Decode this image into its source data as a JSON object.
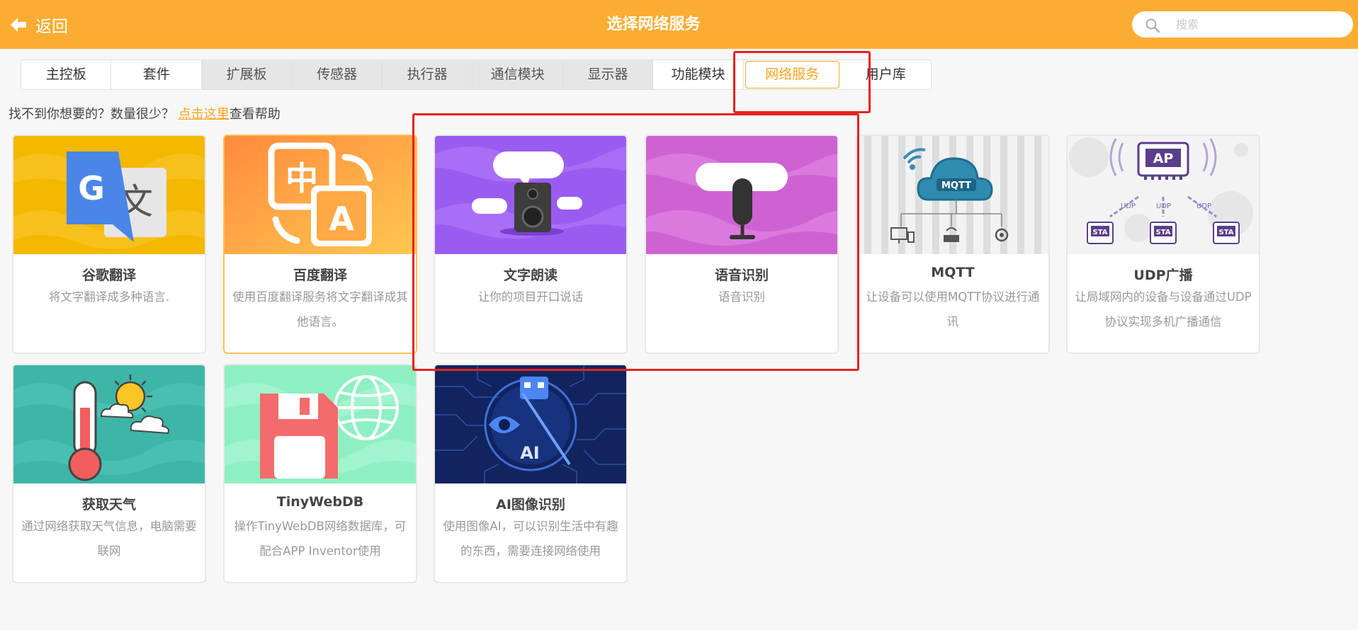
{
  "header": {
    "back_label": "返回",
    "title": "选择网络服务",
    "search_placeholder": "搜索",
    "search_value": ""
  },
  "tabs": [
    {
      "label": "主控板",
      "state": "normal"
    },
    {
      "label": "套件",
      "state": "normal"
    },
    {
      "label": "扩展板",
      "state": "grey"
    },
    {
      "label": "传感器",
      "state": "grey"
    },
    {
      "label": "执行器",
      "state": "grey"
    },
    {
      "label": "通信模块",
      "state": "grey"
    },
    {
      "label": "显示器",
      "state": "grey"
    },
    {
      "label": "功能模块",
      "state": "normal"
    },
    {
      "label": "网络服务",
      "state": "active"
    },
    {
      "label": "用户库",
      "state": "normal"
    }
  ],
  "hint": {
    "prefix": "找不到你想要的？数量很少？",
    "link": "点击这里",
    "suffix": "查看帮助"
  },
  "cards": [
    {
      "name": "谷歌翻译",
      "desc": "将文字翻译成多种语言."
    },
    {
      "name": "百度翻译",
      "desc": "使用百度翻译服务将文字翻译成其他语言。"
    },
    {
      "name": "文字朗读",
      "desc": "让你的项目开口说话"
    },
    {
      "name": "语音识别",
      "desc": "语音识别"
    },
    {
      "name": "MQTT",
      "desc": "让设备可以使用MQTT协议进行通讯"
    },
    {
      "name": "UDP广播",
      "desc": "让局域网内的设备与设备通过UDP协议实现多机广播通信"
    },
    {
      "name": "获取天气",
      "desc": "通过网络获取天气信息，电脑需要联网"
    },
    {
      "name": "TinyWebDB",
      "desc": "操作TinyWebDB网络数据库，可配合APP Inventor使用"
    },
    {
      "name": "AI图像识别",
      "desc": "使用图像AI，可以识别生活中有趣的东西，需要连接网络使用"
    }
  ],
  "image_text": {
    "google_g": "G",
    "google_wen": "文",
    "baidu_zhong": "中",
    "baidu_a": "A",
    "mqtt_label": "MQTT",
    "udp_ap": "AP",
    "udp_label": "UDP",
    "udp_sta": "STA",
    "ai_label": "AI"
  },
  "colors": {
    "header": "#fbad33",
    "accent": "#f6a623",
    "annotation": "#e82121"
  }
}
